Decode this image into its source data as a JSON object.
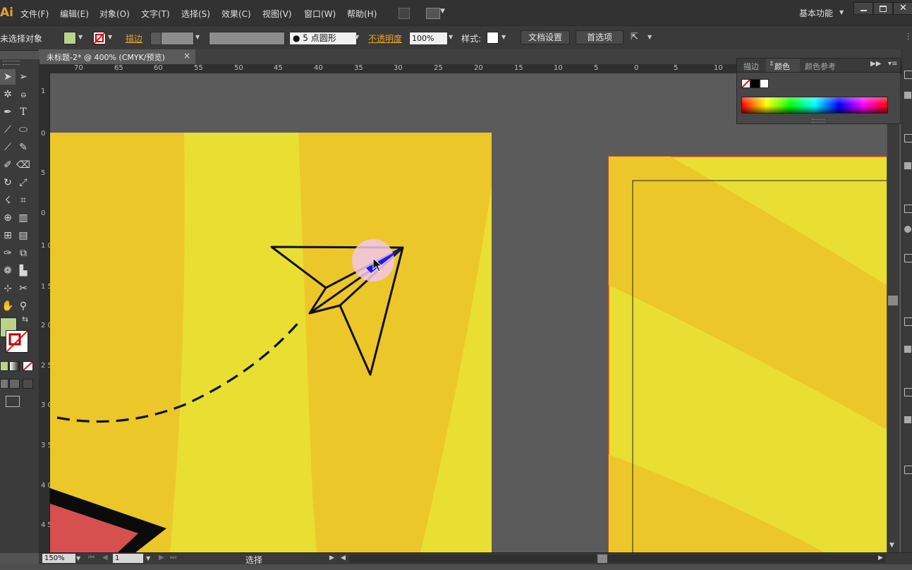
{
  "app": {
    "logo": "Ai",
    "workspace": "基本功能"
  },
  "menu": [
    "文件(F)",
    "编辑(E)",
    "对象(O)",
    "文字(T)",
    "选择(S)",
    "效果(C)",
    "视图(V)",
    "窗口(W)",
    "帮助(H)"
  ],
  "control": {
    "selection_status": "未选择对象",
    "stroke_label": "描边",
    "brush_label": "5 点圆形",
    "opacity_label": "不透明度",
    "opacity_value": "100%",
    "style_label": "样式:",
    "doc_setup": "文档设置",
    "preferences": "首选项"
  },
  "document_tab": {
    "title": "未标题-2* @ 400% (CMYK/预览)",
    "close": "×"
  },
  "ruler": {
    "horizontal": [
      "70",
      "65",
      "60",
      "55",
      "50",
      "45",
      "40",
      "35",
      "30",
      "25",
      "20",
      "15",
      "10",
      "5",
      "0",
      "5",
      "10"
    ],
    "vertical": [
      "1",
      "0",
      "5",
      "0",
      "5",
      "1 0",
      "1 5",
      "2 0",
      "2 5",
      "3 0",
      "3 5",
      "4 0",
      "4 5"
    ]
  },
  "panel": {
    "tabs": [
      "描边",
      "颜色",
      "颜色参考"
    ],
    "active_tab": "颜色"
  },
  "status": {
    "zoom": "150%",
    "page": "1",
    "tool": "选择"
  },
  "colors": {
    "yellow_base": "#ecc72a",
    "yellow_light": "#e9df33",
    "accent_orange": "#e8a22d",
    "fill_swatch": "#b9d48a",
    "red_shape": "#d65050"
  },
  "icons": [
    "selection-tool-icon",
    "direct-selection-icon",
    "magic-wand-icon",
    "lasso-icon",
    "pen-icon",
    "type-icon",
    "line-icon",
    "ellipse-icon",
    "brush-icon",
    "pencil-icon",
    "blob-brush-icon",
    "eraser-icon",
    "rotate-icon",
    "scale-icon",
    "warp-icon",
    "free-transform-icon",
    "shape-builder-icon",
    "graph-icon",
    "mesh-icon",
    "gradient-icon",
    "eyedropper-icon",
    "blend-icon",
    "symbol-sprayer-icon",
    "column-graph-icon",
    "artboard-icon",
    "slice-icon",
    "hand-icon",
    "zoom-icon"
  ]
}
